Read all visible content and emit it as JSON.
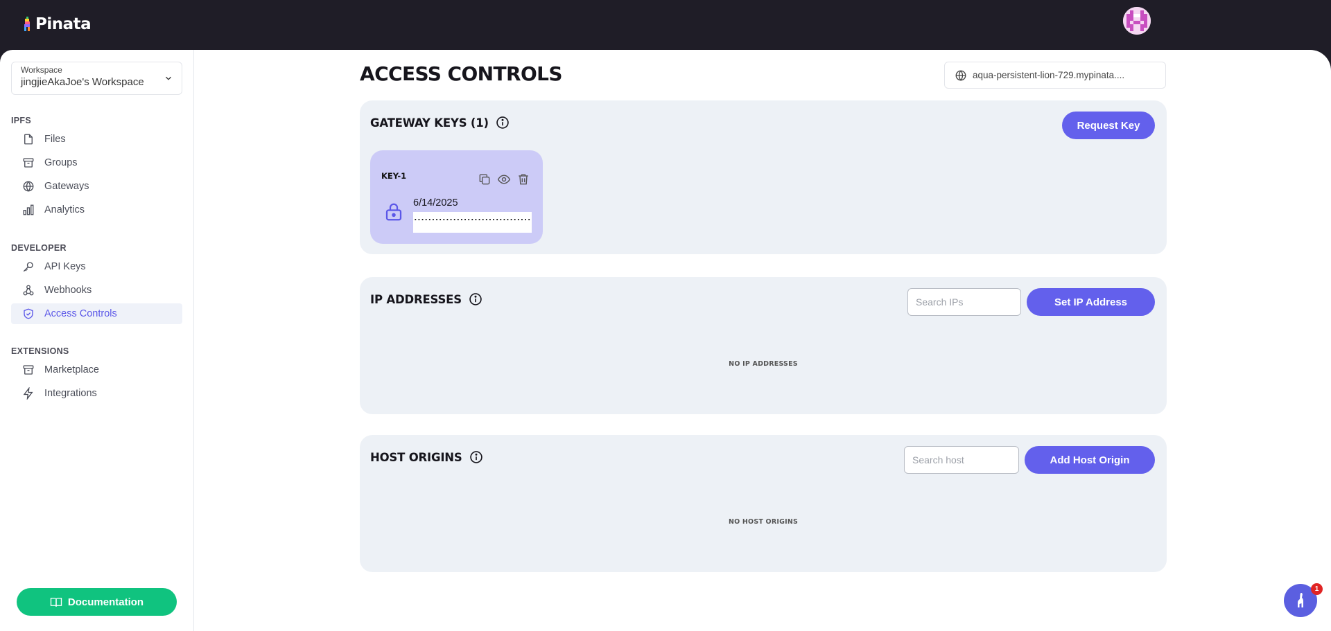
{
  "app": {
    "brand": "Pinata"
  },
  "workspace": {
    "caption": "Workspace",
    "name": "jingjieAkaJoe's Workspace"
  },
  "sidebar": {
    "sections": [
      {
        "title": "IPFS",
        "items": [
          {
            "label": "Files",
            "icon": "file-icon"
          },
          {
            "label": "Groups",
            "icon": "archive-icon"
          },
          {
            "label": "Gateways",
            "icon": "globe-icon"
          },
          {
            "label": "Analytics",
            "icon": "bar-chart-icon"
          }
        ]
      },
      {
        "title": "DEVELOPER",
        "items": [
          {
            "label": "API Keys",
            "icon": "key-icon"
          },
          {
            "label": "Webhooks",
            "icon": "webhook-icon"
          },
          {
            "label": "Access Controls",
            "icon": "shield-check-icon",
            "active": true
          }
        ]
      },
      {
        "title": "EXTENSIONS",
        "items": [
          {
            "label": "Marketplace",
            "icon": "archive-icon"
          },
          {
            "label": "Integrations",
            "icon": "bolt-icon"
          }
        ]
      }
    ],
    "documentation_label": "Documentation"
  },
  "main": {
    "title": "ACCESS CONTROLS",
    "gateway_url": "aqua-persistent-lion-729.mypinata...."
  },
  "gateway_keys": {
    "title": "GATEWAY KEYS (1)",
    "request_label": "Request Key",
    "keys": [
      {
        "name": "KEY-1",
        "date": "6/14/2025",
        "masked": "·································"
      }
    ]
  },
  "ip_addresses": {
    "title": "IP ADDRESSES",
    "search_placeholder": "Search IPs",
    "button_label": "Set IP Address",
    "empty_label": "NO IP ADDRESSES"
  },
  "host_origins": {
    "title": "HOST ORIGINS",
    "search_placeholder": "Search host",
    "button_label": "Add Host Origin",
    "empty_label": "NO HOST ORIGINS"
  },
  "chat": {
    "badge_count": "1"
  },
  "colors": {
    "accent": "#6360ec",
    "doc_button": "#10c37f",
    "topbar": "#1f1d27",
    "card_bg": "#edf1f6",
    "key_card": "#cccbf7"
  }
}
